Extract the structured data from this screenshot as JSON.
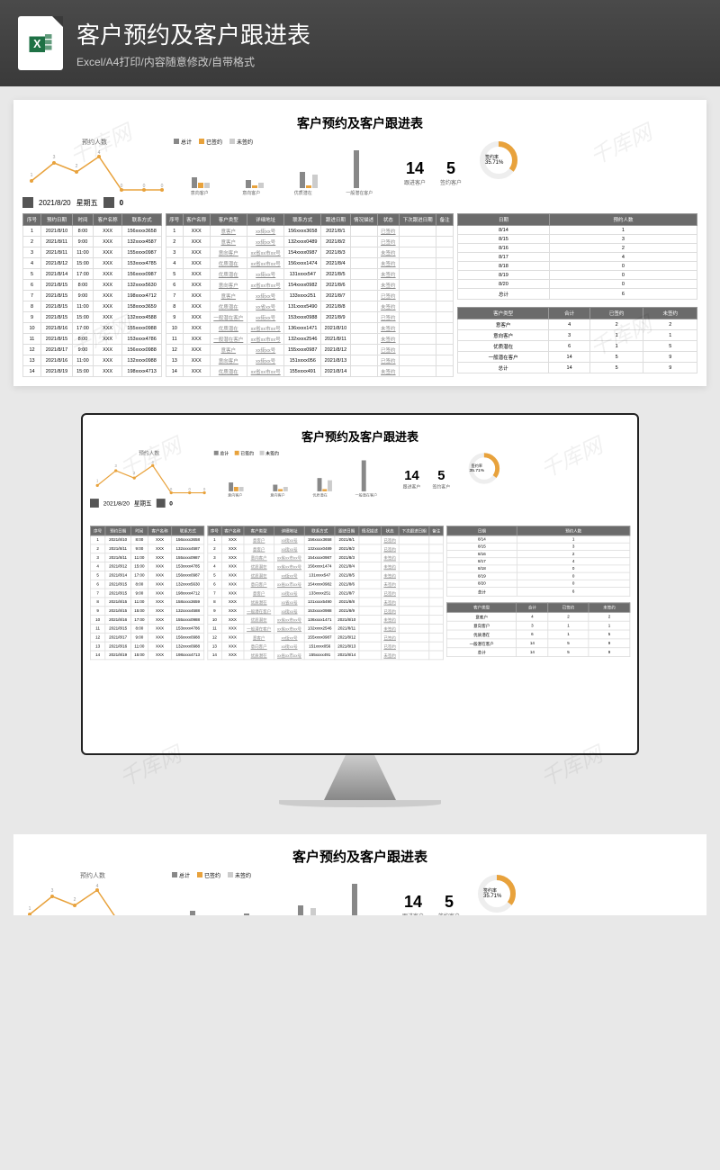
{
  "header": {
    "title": "客户预约及客户跟进表",
    "sub": "Excel/A4打印/内容随意修改/自带格式"
  },
  "watermark": "千库网",
  "sheet": {
    "title": "客户预约及客户跟进表"
  },
  "lineChart": {
    "label": "预约人数",
    "x": [
      "8/14",
      "8/15",
      "8/16",
      "8/17",
      "8/18",
      "8/19",
      "8/20"
    ],
    "y": [
      1,
      3,
      2,
      4,
      0,
      0,
      0
    ]
  },
  "dateBar": {
    "date": "2021/8/20",
    "weekday": "星期五",
    "count": "0"
  },
  "barChart": {
    "legend": [
      "总计",
      "已签约",
      "未签约"
    ],
    "cats": [
      "意向客户",
      "意向客户",
      "优质潜在",
      "一般潜在客户"
    ],
    "series": [
      [
        4,
        3,
        6,
        14
      ],
      [
        2,
        1,
        1,
        0
      ],
      [
        2,
        2,
        5,
        0
      ]
    ]
  },
  "stats": {
    "follow_n": "14",
    "follow_l": "跟进客户",
    "sign_n": "5",
    "sign_l": "签约客户"
  },
  "gauge": {
    "label": "签约率",
    "pct": "35.71%"
  },
  "t1": {
    "headers": [
      "序号",
      "预约日期",
      "时间",
      "客户名称",
      "联系方式"
    ],
    "rows": [
      [
        "1",
        "2021/8/10",
        "8:00",
        "XXX",
        "156xxxx3658"
      ],
      [
        "2",
        "2021/8/11",
        "9:00",
        "XXX",
        "132xxxx4587"
      ],
      [
        "3",
        "2021/8/11",
        "11:00",
        "XXX",
        "155xxxx0987"
      ],
      [
        "4",
        "2021/8/12",
        "15:00",
        "XXX",
        "153xxxx4785"
      ],
      [
        "5",
        "2021/8/14",
        "17:00",
        "XXX",
        "156xxxx0987"
      ],
      [
        "6",
        "2021/8/15",
        "8:00",
        "XXX",
        "132xxxx5630"
      ],
      [
        "7",
        "2021/8/15",
        "9:00",
        "XXX",
        "198xxxx4712"
      ],
      [
        "8",
        "2021/8/15",
        "11:00",
        "XXX",
        "158xxxx3659"
      ],
      [
        "9",
        "2021/8/15",
        "15:00",
        "XXX",
        "132xxxx4588"
      ],
      [
        "10",
        "2021/8/16",
        "17:00",
        "XXX",
        "155xxxx0988"
      ],
      [
        "11",
        "2021/8/15",
        "8:00",
        "XXX",
        "153xxxx4786"
      ],
      [
        "12",
        "2021/8/17",
        "9:00",
        "XXX",
        "156xxxx0988"
      ],
      [
        "13",
        "2021/8/16",
        "11:00",
        "XXX",
        "132xxxx0988"
      ],
      [
        "14",
        "2021/8/19",
        "15:00",
        "XXX",
        "198xxxx4713"
      ]
    ]
  },
  "t2": {
    "headers": [
      "序号",
      "客户名称",
      "客户类型",
      "详细地址",
      "联系方式",
      "跟进日期",
      "情况描述",
      "状态",
      "下次跟进日期",
      "备注"
    ],
    "rows": [
      [
        "1",
        "XXX",
        "意客户",
        "xx街xx号",
        "156xxxx3658",
        "2021/8/1",
        "",
        "已签约",
        "",
        ""
      ],
      [
        "2",
        "XXX",
        "意客户",
        "xx街xx号",
        "132xxxx0489",
        "2021/8/2",
        "",
        "已签约",
        "",
        ""
      ],
      [
        "3",
        "XXX",
        "意向客户",
        "xx省xx市xx号",
        "154xxxx0987",
        "2021/8/3",
        "",
        "未签约",
        "",
        ""
      ],
      [
        "4",
        "XXX",
        "优质潜在",
        "xx省xx市xx号",
        "156xxxx1474",
        "2021/8/4",
        "",
        "未签约",
        "",
        ""
      ],
      [
        "5",
        "XXX",
        "优质潜在",
        "xx街xx号",
        "131xxxx547",
        "2021/8/5",
        "",
        "未签约",
        "",
        ""
      ],
      [
        "6",
        "XXX",
        "意向客户",
        "xx省xx市xx号",
        "154xxxx0982",
        "2021/8/6",
        "",
        "未签约",
        "",
        ""
      ],
      [
        "7",
        "XXX",
        "意客户",
        "xx街xx号",
        "133xxxx251",
        "2021/8/7",
        "",
        "已签约",
        "",
        ""
      ],
      [
        "8",
        "XXX",
        "优质潜在",
        "xx省xx号",
        "131xxxx5490",
        "2021/8/8",
        "",
        "未签约",
        "",
        ""
      ],
      [
        "9",
        "XXX",
        "一般潜在客户",
        "xx街xx号",
        "153xxxx0988",
        "2021/8/9",
        "",
        "已签约",
        "",
        ""
      ],
      [
        "10",
        "XXX",
        "优质潜在",
        "xx省xx市xx号",
        "136xxxx1471",
        "2021/8/10",
        "",
        "未签约",
        "",
        ""
      ],
      [
        "11",
        "XXX",
        "一般潜在客户",
        "xx省xx市xx号",
        "132xxxx2546",
        "2021/8/11",
        "",
        "未签约",
        "",
        ""
      ],
      [
        "12",
        "XXX",
        "意客户",
        "xx街xx号",
        "155xxxx0987",
        "2021/8/12",
        "",
        "已签约",
        "",
        ""
      ],
      [
        "13",
        "XXX",
        "意向客户",
        "xx街xx号",
        "151xxxx056",
        "2021/8/13",
        "",
        "已签约",
        "",
        ""
      ],
      [
        "14",
        "XXX",
        "优质潜在",
        "xx省xx市xx号",
        "155xxxx491",
        "2021/8/14",
        "",
        "未签约",
        "",
        ""
      ]
    ]
  },
  "t3": {
    "headers": [
      "日期",
      "预约人数"
    ],
    "rows": [
      [
        "8/14",
        "1"
      ],
      [
        "8/15",
        "3"
      ],
      [
        "8/16",
        "2"
      ],
      [
        "8/17",
        "4"
      ],
      [
        "8/18",
        "0"
      ],
      [
        "8/19",
        "0"
      ],
      [
        "8/20",
        "0"
      ],
      [
        "总计",
        "6"
      ]
    ]
  },
  "t4": {
    "headers": [
      "客户类型",
      "合计",
      "已签约",
      "未签约"
    ],
    "rows": [
      [
        "意客户",
        "4",
        "2",
        "2"
      ],
      [
        "意向客户",
        "3",
        "1",
        "1"
      ],
      [
        "优质潜在",
        "6",
        "1",
        "5"
      ],
      [
        "一般潜在客户",
        "14",
        "5",
        "9"
      ],
      [
        "总计",
        "14",
        "5",
        "9"
      ]
    ]
  },
  "chart_data": [
    {
      "type": "line",
      "title": "预约人数",
      "categories": [
        "8/14",
        "8/15",
        "8/16",
        "8/17",
        "8/18",
        "8/19",
        "8/20"
      ],
      "values": [
        1,
        3,
        2,
        4,
        0,
        0,
        0
      ]
    },
    {
      "type": "bar",
      "categories": [
        "意向客户",
        "意向客户",
        "优质潜在",
        "一般潜在客户"
      ],
      "series": [
        {
          "name": "总计",
          "values": [
            4,
            3,
            6,
            14
          ]
        },
        {
          "name": "已签约",
          "values": [
            2,
            1,
            1,
            0
          ]
        },
        {
          "name": "未签约",
          "values": [
            2,
            2,
            5,
            0
          ]
        }
      ]
    },
    {
      "type": "pie",
      "title": "签约率",
      "values": [
        35.71,
        64.29
      ]
    }
  ]
}
